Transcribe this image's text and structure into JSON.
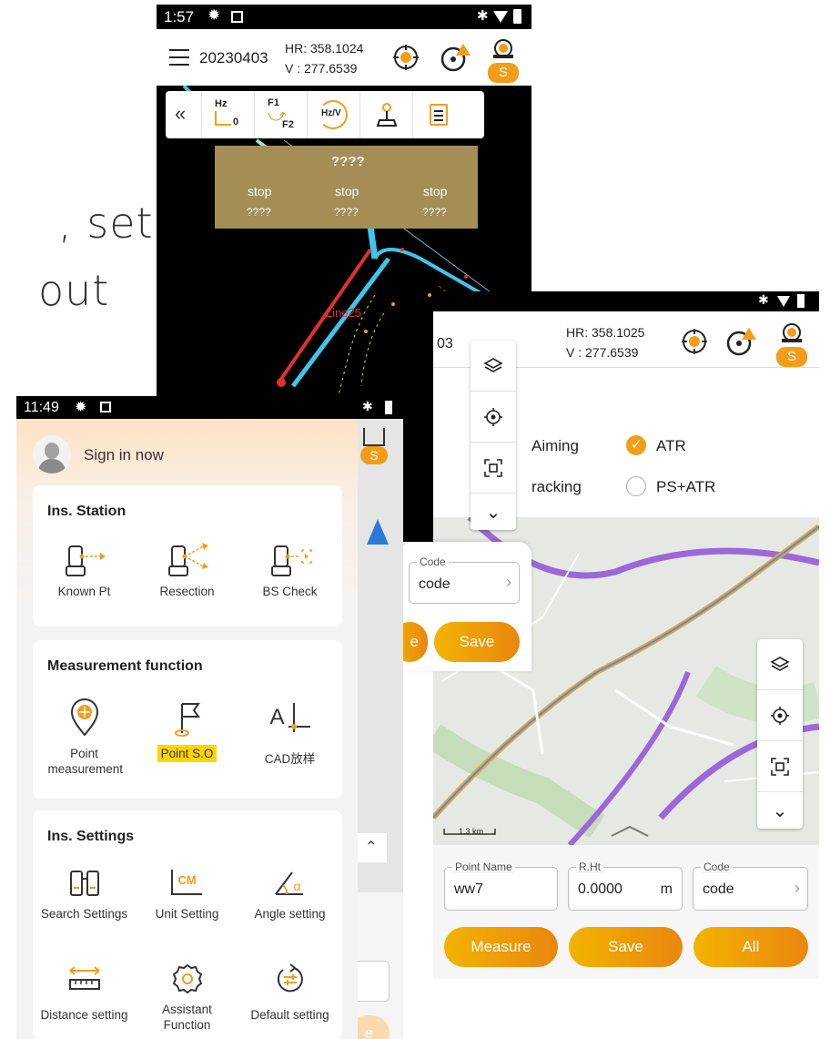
{
  "hero_text": {
    "line1": ", set",
    "line2": "out"
  },
  "colors": {
    "accent": "#f29d18",
    "accent_light": "#f3b300",
    "map_bg": "#000000",
    "highlight": "#ffd400"
  },
  "screen1": {
    "status": {
      "time": "1:57"
    },
    "appbar": {
      "project": "20230403",
      "hr": "HR: 358.1024",
      "v": "V  : 277.6539",
      "station_badge": "S"
    },
    "toolbar": {
      "hz_label": "Hz",
      "hz_sub": "0",
      "f1_label": "F1",
      "f2_label": "F2",
      "hzv_label": "Hz/V"
    },
    "stop_panel": {
      "title": "????",
      "col1_status": "stop",
      "col2_status": "stop",
      "col3_status": "stop",
      "col1_value": "????",
      "col2_value": "????",
      "col3_value": "????"
    },
    "map_label": "Line25",
    "popup": {
      "code_label": "Code",
      "code_value": "code",
      "partial_button": "e",
      "save_button": "Save"
    }
  },
  "screen2": {
    "appbar": {
      "project_partial": "03",
      "hr": "HR: 358.1025",
      "v": "V  : 277.6539",
      "station_badge": "S"
    },
    "options": {
      "aiming_label": "Aiming",
      "atr_label": "ATR",
      "atr_checked": true,
      "tracking_label": "racking",
      "psatr_label": "PS+ATR",
      "psatr_checked": false
    },
    "scale_label": "1.3 km",
    "form": {
      "point_name_label": "Point Name",
      "point_name_value": "ww7",
      "rht_label": "R.Ht",
      "rht_value": "0.0000",
      "rht_unit": "m",
      "code_label": "Code",
      "code_value": "code"
    },
    "buttons": {
      "measure": "Measure",
      "save": "Save",
      "all": "All"
    }
  },
  "screen3": {
    "status": {
      "time": "11:49"
    },
    "sign_in": "Sign in now",
    "station_badge": "S",
    "sections": {
      "station": {
        "title": "Ins. Station",
        "items": [
          "Known Pt",
          "Resection",
          "BS Check"
        ]
      },
      "measurement": {
        "title": "Measurement function",
        "items": [
          "Point measurement",
          "Point S.O",
          "CAD放样"
        ]
      },
      "settings": {
        "title": "Ins. Settings",
        "items": [
          "Search Settings",
          "Unit Setting",
          "Angle setting",
          "Distance setting",
          "Assistant Function",
          "Default setting"
        ]
      }
    },
    "unit_icon_text": "CM",
    "angle_icon_text": "α",
    "cad_icon_text": "A",
    "partial_button": "e"
  }
}
